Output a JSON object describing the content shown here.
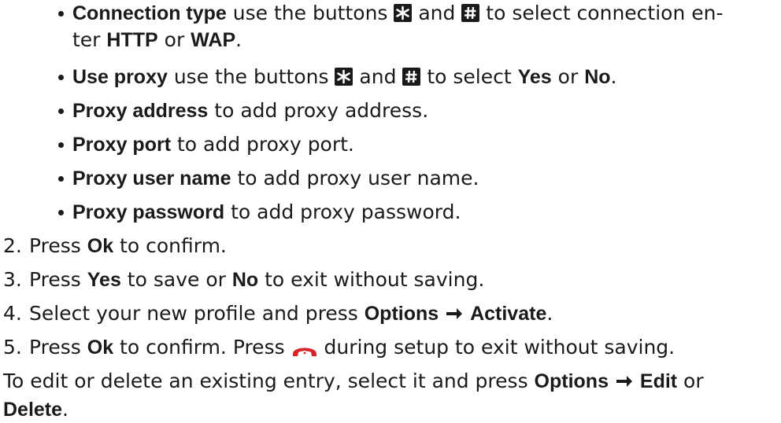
{
  "bullets": [
    {
      "bold": "Connection type",
      "a": " use the buttons ",
      "icon1": "star-key-icon",
      "b": " and ",
      "icon2": "hash-key-icon",
      "c": " to select connection en-",
      "cont_prefix": "ter ",
      "bold2": "HTTP",
      "cont_mid": " or ",
      "bold3": "WAP",
      "cont_end": "."
    },
    {
      "bold": "Use proxy",
      "a": " use the buttons ",
      "icon1": "star-key-icon",
      "b": " and ",
      "icon2": "hash-key-icon",
      "c": " to select ",
      "bold2": "Yes",
      "mid": " or ",
      "bold3": "No",
      "end": "."
    },
    {
      "bold": "Proxy address",
      "rest": " to add proxy address."
    },
    {
      "bold": "Proxy port",
      "rest": " to add proxy port."
    },
    {
      "bold": "Proxy user name",
      "rest": " to add proxy user name."
    },
    {
      "bold": "Proxy password",
      "rest": " to add proxy password."
    }
  ],
  "steps": [
    {
      "num": "2.",
      "pre": "Press ",
      "bold": "Ok",
      "post": " to confirm."
    },
    {
      "num": "3.",
      "pre": "Press ",
      "bold": "Yes",
      "mid": " to save or ",
      "bold2": "No",
      "post": " to exit without saving."
    },
    {
      "num": "4.",
      "pre": "Select your new profile and press ",
      "bold": "Options",
      "arrow": "right-arrow-icon",
      "bold2": "Activate",
      "post": "."
    },
    {
      "num": "5.",
      "pre": "Press ",
      "bold": "Ok",
      "mid": " to confirm. Press ",
      "icon": "end-call-icon",
      "post": " during setup to exit without saving."
    }
  ],
  "closing": {
    "line1_pre": "To edit or delete an existing entry, select it and press ",
    "bold1": "Options",
    "arrow": "right-arrow-icon",
    "bold2": "Edit",
    "line1_post": " or",
    "bold3": "Delete",
    "line2_post": "."
  }
}
